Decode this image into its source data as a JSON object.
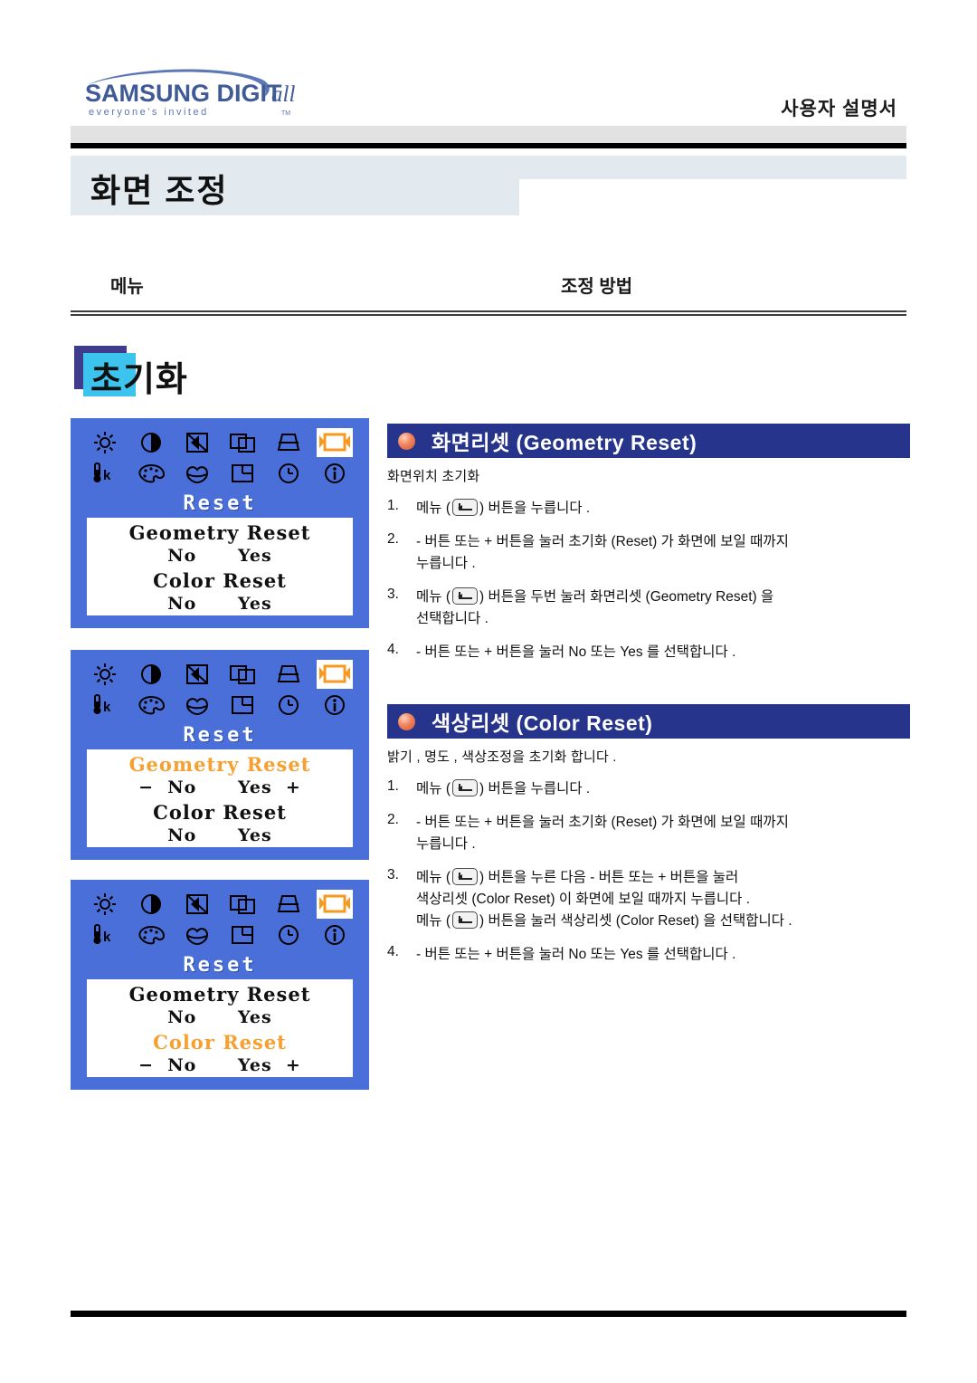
{
  "header": {
    "logo_main": "SAMSUNG DIGITall",
    "logo_tagline": "everyone's invitedTM",
    "manual_title": "사용자 설명서"
  },
  "page": {
    "title": "화면 조정"
  },
  "columns": {
    "menu": "메뉴",
    "method": "조정 방법"
  },
  "section": {
    "title": "초기화",
    "accent_color": "#3cc4ef",
    "shadow_color": "#3f3c8c"
  },
  "osd": {
    "bg_color": "#4a6fd8",
    "highlight_color": "#f5a030",
    "menu_title": "Reset",
    "icons_row1": [
      "brightness-icon",
      "contrast-icon",
      "sharpness-icon",
      "position-icon",
      "trapezoid-icon",
      "reset-icon"
    ],
    "icons_row2": [
      "color-temperature-icon",
      "palette-icon",
      "gamma-icon",
      "image-size-icon",
      "osd-timer-icon",
      "information-icon"
    ],
    "selected_icon": "reset-icon",
    "screens": [
      {
        "name": "reset-menu-default",
        "line1": "Geometry Reset",
        "line2": "No      Yes",
        "line3": "Color Reset",
        "line4": "No      Yes",
        "highlight": "none"
      },
      {
        "name": "geometry-reset-selected",
        "line1": "Geometry Reset",
        "line2": "−  No      Yes  +",
        "line3": "Color Reset",
        "line4": "No      Yes",
        "highlight": "line1"
      },
      {
        "name": "color-reset-selected",
        "line1": "Geometry Reset",
        "line2": "No      Yes",
        "line3": "Color Reset",
        "line4": "−  No      Yes  +",
        "highlight": "line3"
      }
    ]
  },
  "features": [
    {
      "title": "화면리셋 (Geometry Reset)",
      "subtitle": "화면위치 초기화",
      "steps": [
        {
          "num": "1.",
          "lines": [
            "메뉴 ( ",
            " ) 버튼을 누릅니다 ."
          ]
        },
        {
          "num": "2.",
          "lines": [
            "-  버튼 또는 + 버튼을 눌러 초기화 (Reset) 가 화면에 보일 때까지",
            "누릅니다 ."
          ]
        },
        {
          "num": "3.",
          "lines": [
            "메뉴 ( ",
            " ) 버튼을 두번 눌러 화면리셋 (Geometry Reset) 을",
            "선택합니다 ."
          ]
        },
        {
          "num": "4.",
          "lines": [
            "-  버튼 또는 + 버튼을 눌러 No 또는 Yes 를 선택합니다 ."
          ]
        }
      ]
    },
    {
      "title": "색상리셋 (Color Reset)",
      "subtitle": "밝기 , 명도 , 색상조정을 초기화 합니다 .",
      "steps": [
        {
          "num": "1.",
          "lines": [
            "메뉴 ( ",
            " ) 버튼을 누릅니다 ."
          ]
        },
        {
          "num": "2.",
          "lines": [
            "-  버튼 또는 + 버튼을 눌러 초기화 (Reset) 가 화면에 보일 때까지",
            "누릅니다 ."
          ]
        },
        {
          "num": "3.",
          "lines": [
            "메뉴 ( ",
            " ) 버튼을 누른 다음 -  버튼 또는 + 버튼을 눌러",
            "색상리셋 (Color Reset) 이 화면에 보일 때까지 누릅니다 .",
            "메뉴 ( ",
            " ) 버튼을 눌러 색상리셋 (Color Reset) 을 선택합니다 ."
          ]
        },
        {
          "num": "4.",
          "lines": [
            "-  버튼 또는 + 버튼을 눌러 No 또는 Yes 를 선택합니다 ."
          ]
        }
      ]
    }
  ],
  "step_text": {
    "f1s1a": "메뉴 (",
    "f1s1b": ") 버튼을 누릅니다 .",
    "f1s2a": "-  버튼 또는 + 버튼을 눌러 초기화 (Reset) 가 화면에 보일 때까지",
    "f1s2b": "누릅니다 .",
    "f1s3a": "메뉴 (",
    "f1s3b": ") 버튼을 두번 눌러 화면리셋 (Geometry Reset) 을",
    "f1s3c": "선택합니다 .",
    "f1s4a": "-  버튼 또는 + 버튼을 눌러 No 또는 Yes 를 선택합니다 .",
    "f2s1a": "메뉴 (",
    "f2s1b": ") 버튼을 누릅니다 .",
    "f2s2a": "-  버튼 또는 + 버튼을 눌러 초기화 (Reset) 가 화면에 보일 때까지",
    "f2s2b": "누릅니다 .",
    "f2s3a": "메뉴 (",
    "f2s3b": ") 버튼을 누른 다음 -  버튼 또는 + 버튼을 눌러",
    "f2s3c": "색상리셋 (Color Reset) 이 화면에 보일 때까지 누릅니다 .",
    "f2s3d": "메뉴 (",
    "f2s3e": ") 버튼을 눌러 색상리셋 (Color Reset) 을 선택합니다 .",
    "f2s4a": "-  버튼 또는 + 버튼을 눌러 No 또는 Yes 를 선택합니다 ."
  }
}
